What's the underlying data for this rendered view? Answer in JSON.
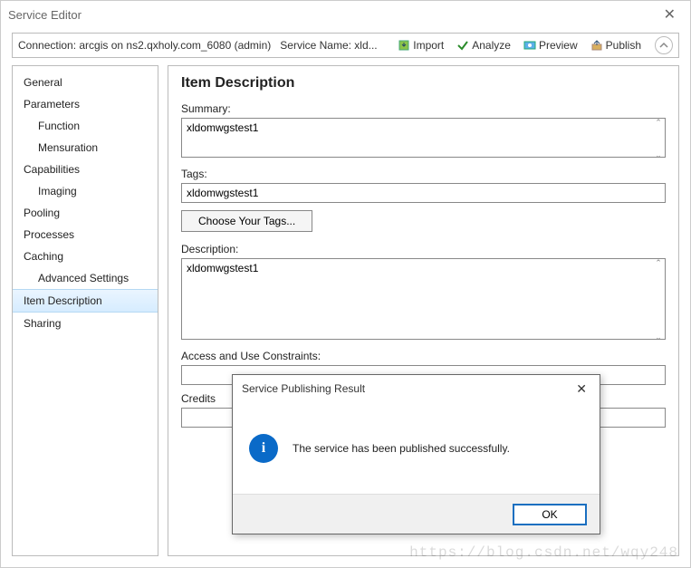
{
  "window": {
    "title": "Service Editor"
  },
  "toolbar": {
    "connection": "Connection: arcgis on ns2.qxholy.com_6080 (admin)",
    "service_name_label": "Service Name: xld...",
    "import": "Import",
    "analyze": "Analyze",
    "preview": "Preview",
    "publish": "Publish"
  },
  "sidebar": {
    "items": [
      {
        "label": "General",
        "sub": false
      },
      {
        "label": "Parameters",
        "sub": false
      },
      {
        "label": "Function",
        "sub": true
      },
      {
        "label": "Mensuration",
        "sub": true
      },
      {
        "label": "Capabilities",
        "sub": false
      },
      {
        "label": "Imaging",
        "sub": true
      },
      {
        "label": "Pooling",
        "sub": false
      },
      {
        "label": "Processes",
        "sub": false
      },
      {
        "label": "Caching",
        "sub": false
      },
      {
        "label": "Advanced Settings",
        "sub": true
      },
      {
        "label": "Item Description",
        "sub": false,
        "selected": true
      },
      {
        "label": "Sharing",
        "sub": false
      }
    ]
  },
  "main": {
    "heading": "Item Description",
    "summary_label": "Summary:",
    "summary_value": "xldomwgstest1",
    "tags_label": "Tags:",
    "tags_value": "xldomwgstest1",
    "choose_tags_btn": "Choose Your Tags...",
    "description_label": "Description:",
    "description_value": "xldomwgstest1",
    "access_label": "Access and Use Constraints:",
    "access_value": "",
    "credits_label": "Credits",
    "credits_value": ""
  },
  "dialog": {
    "title": "Service Publishing Result",
    "message": "The service has been published successfully.",
    "ok": "OK"
  },
  "watermark": "https://blog.csdn.net/wqy248"
}
